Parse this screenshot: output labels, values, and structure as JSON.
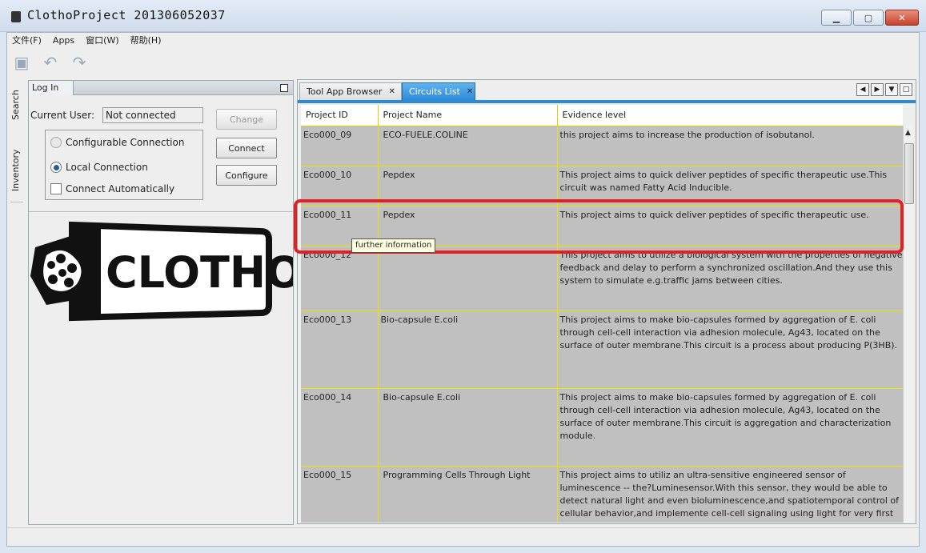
{
  "window": {
    "title": "ClothoProject 201306052037",
    "minimize_symbol": "▁",
    "maximize_symbol": "▢",
    "close_symbol": "✕"
  },
  "menu": [
    "文件(F)",
    "Apps",
    "窗口(W)",
    "帮助(H)"
  ],
  "toolbar": {
    "icons": [
      "save-all-icon",
      "undo-icon",
      "redo-icon"
    ],
    "glyphs": [
      "▣",
      "↶",
      "↷"
    ]
  },
  "side_tabs": {
    "search": "Search",
    "inventory": "Inventory"
  },
  "login": {
    "tab_label": "Log In",
    "current_user_label": "Current User:",
    "current_user_value": "Not connected",
    "configurable_connection": "Configurable Connection",
    "local_connection": "Local Connection",
    "connect_automatically": "Connect Automatically",
    "change_button": "Change",
    "connect_button": "Connect",
    "configure_button": "Configure",
    "logo_text": "CLOTHO"
  },
  "tabs": {
    "tool_app_browser": "Tool App Browser",
    "circuits_list": "Circuits List",
    "close_symbol": "✕",
    "nav": [
      "◀",
      "▶",
      "▼",
      "□"
    ]
  },
  "table": {
    "headers": [
      "Project ID",
      "Project Name",
      "Evidence level"
    ],
    "rows": [
      {
        "id": "Eco000_09",
        "name": "ECO-FUELE.COLINE",
        "evidence": "this project aims to increase the production of isobutanol."
      },
      {
        "id": "Eco000_10",
        "name": "Pepdex",
        "evidence": "This project aims to quick deliver peptides of specific therapeutic use.This circuit was named Fatty Acid Inducible."
      },
      {
        "id": "Eco000_11",
        "name": "Pepdex",
        "evidence": "This project aims to quick deliver peptides of specific therapeutic use."
      },
      {
        "id": "Eco000_12",
        "name": "",
        "evidence": "This project aims to utilize a biological system with the properties of negative feedback and delay to perform a synchronized oscillation.And they use this system to simulate e.g.traffic jams between cities."
      },
      {
        "id": "Eco000_13",
        "name": "Bio-capsule E.coli",
        "evidence": "This project aims to make bio-capsules formed by aggregation of E. coli through cell-cell interaction via adhesion molecule, Ag43, located on the surface of outer membrane.This circuit is a process about producing P(3HB)."
      },
      {
        "id": "Eco000_14",
        "name": "Bio-capsule E.coli",
        "evidence": "This project aims to make bio-capsules formed by aggregation of E. coli through cell-cell interaction via adhesion molecule, Ag43, located on the surface of outer membrane.This circuit is aggregation and characterization module."
      },
      {
        "id": "Eco000_15",
        "name": "Programming Cells Through Light",
        "evidence": "This project aims to utiliz an ultra-sensitive engineered sensor of luminescence -- the?Luminesensor.With this sensor, they would be able to detect natural light and even bioluminescence,and spatiotemporal control of cellular behavior,and implemente cell-cell signaling using light for very first time ."
      }
    ]
  },
  "tooltip": "further information",
  "colors": {
    "row_bg": "#c0c0c0",
    "grid_line": "#e9e400",
    "active_tab": "#2f8ad6",
    "highlight_ring": "#e62020"
  }
}
